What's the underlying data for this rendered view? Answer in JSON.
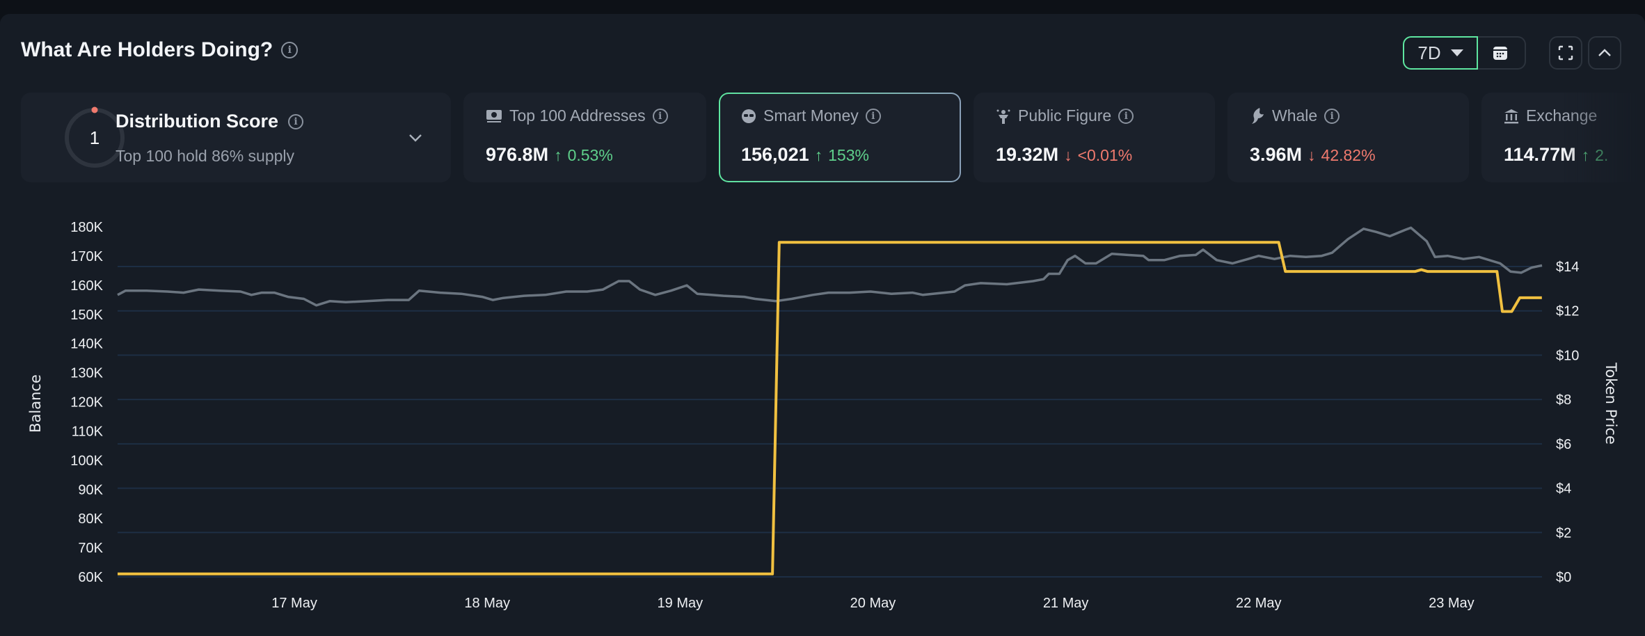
{
  "header": {
    "title": "What Are Holders Doing?",
    "range": "7D"
  },
  "colors": {
    "accent": "#5ee6a0",
    "balance_line": "#f0c040",
    "price_line": "#6b7580",
    "up": "#5fd08b",
    "down": "#f07a6e",
    "grid": "#1d2e44"
  },
  "distribution": {
    "score": "1",
    "title": "Distribution Score",
    "subtitle": "Top 100 hold 86% supply"
  },
  "cards": [
    {
      "icon": "money-stack-icon",
      "label": "Top 100 Addresses",
      "value": "976.8M",
      "change": "0.53%",
      "direction": "up",
      "arrow": "↑"
    },
    {
      "icon": "sunglasses-icon",
      "label": "Smart Money",
      "value": "156,021",
      "change": "153%",
      "direction": "up",
      "arrow": "↑",
      "selected": true
    },
    {
      "icon": "public-figure-icon",
      "label": "Public Figure",
      "value": "19.32M",
      "change": "<0.01%",
      "direction": "down",
      "arrow": "↓"
    },
    {
      "icon": "whale-icon",
      "label": "Whale",
      "value": "3.96M",
      "change": "42.82%",
      "direction": "down",
      "arrow": "↓"
    },
    {
      "icon": "bank-icon",
      "label": "Exchange",
      "value": "114.77M",
      "change": "2.",
      "direction": "up",
      "arrow": "↑"
    }
  ],
  "chart_data": {
    "type": "line",
    "left_axis": {
      "label": "Balance",
      "ylim": [
        60000,
        180000
      ],
      "ticks": [
        "180K",
        "170K",
        "160K",
        "150K",
        "140K",
        "130K",
        "120K",
        "110K",
        "100K",
        "90K",
        "80K",
        "70K",
        "60K"
      ]
    },
    "right_axis": {
      "label": "Token Price",
      "ylim": [
        0,
        16
      ],
      "ticks": [
        "$14",
        "$12",
        "$10",
        "$8",
        "$6",
        "$4",
        "$2",
        "$0"
      ]
    },
    "x_ticks": [
      "17 May",
      "18 May",
      "19 May",
      "20 May",
      "21 May",
      "22 May",
      "23 May"
    ],
    "xlim": [
      "05-16 02:00",
      "05-23 11:16"
    ],
    "grid": "horizontal at right-axis ticks",
    "series": [
      {
        "axis": "left",
        "color": "#f0c040",
        "step": true,
        "points": [
          [
            "05-16 02:00",
            61000
          ],
          [
            "05-19 11:30",
            61000
          ],
          [
            "05-19 12:20",
            174700
          ],
          [
            "05-22 02:30",
            174700
          ],
          [
            "05-22 03:20",
            164700
          ],
          [
            "05-22 19:30",
            164700
          ],
          [
            "05-22 20:15",
            165300
          ],
          [
            "05-22 21:00",
            164700
          ],
          [
            "05-23 05:40",
            164700
          ],
          [
            "05-23 06:20",
            151000
          ],
          [
            "05-23 07:30",
            151000
          ],
          [
            "05-23 08:30",
            155700
          ],
          [
            "05-23 11:15",
            155700
          ]
        ]
      },
      {
        "axis": "right",
        "color": "#6b7580",
        "points": [
          [
            "05-16 02:00",
            12.72
          ],
          [
            "05-16 03:00",
            12.91
          ],
          [
            "05-16 05:36",
            12.91
          ],
          [
            "05-16 08:12",
            12.87
          ],
          [
            "05-16 10:12",
            12.82
          ],
          [
            "05-16 12:06",
            12.96
          ],
          [
            "05-16 14:42",
            12.91
          ],
          [
            "05-16 17:18",
            12.87
          ],
          [
            "05-16 18:39",
            12.72
          ],
          [
            "05-16 19:57",
            12.82
          ],
          [
            "05-16 21:30",
            12.82
          ],
          [
            "05-16 23:12",
            12.63
          ],
          [
            "05-17 01:11",
            12.54
          ],
          [
            "05-17 02:44",
            12.25
          ],
          [
            "05-17 04:26",
            12.44
          ],
          [
            "05-17 06:24",
            12.39
          ],
          [
            "05-17 09:00",
            12.44
          ],
          [
            "05-17 11:36",
            12.49
          ],
          [
            "05-17 14:14",
            12.49
          ],
          [
            "05-17 15:32",
            12.91
          ],
          [
            "05-17 18:09",
            12.82
          ],
          [
            "05-17 20:46",
            12.77
          ],
          [
            "05-17 23:23",
            12.63
          ],
          [
            "05-18 00:41",
            12.49
          ],
          [
            "05-18 02:00",
            12.58
          ],
          [
            "05-18 04:36",
            12.68
          ],
          [
            "05-18 07:13",
            12.72
          ],
          [
            "05-18 09:50",
            12.87
          ],
          [
            "05-18 12:26",
            12.87
          ],
          [
            "05-18 14:24",
            12.96
          ],
          [
            "05-18 16:21",
            13.34
          ],
          [
            "05-18 17:40",
            13.34
          ],
          [
            "05-18 19:00",
            12.96
          ],
          [
            "05-18 20:55",
            12.72
          ],
          [
            "05-18 22:53",
            12.91
          ],
          [
            "05-19 00:50",
            13.15
          ],
          [
            "05-19 02:08",
            12.77
          ],
          [
            "05-19 05:24",
            12.68
          ],
          [
            "05-19 08:00",
            12.63
          ],
          [
            "05-19 09:20",
            12.54
          ],
          [
            "05-19 11:57",
            12.44
          ],
          [
            "05-19 13:54",
            12.54
          ],
          [
            "05-19 16:31",
            12.72
          ],
          [
            "05-19 18:28",
            12.82
          ],
          [
            "05-19 21:05",
            12.82
          ],
          [
            "05-19 23:42",
            12.87
          ],
          [
            "05-20 02:18",
            12.77
          ],
          [
            "05-20 04:55",
            12.82
          ],
          [
            "05-20 06:13",
            12.72
          ],
          [
            "05-20 08:50",
            12.82
          ],
          [
            "05-20 10:09",
            12.87
          ],
          [
            "05-20 11:27",
            13.15
          ],
          [
            "05-20 13:25",
            13.25
          ],
          [
            "05-20 16:40",
            13.2
          ],
          [
            "05-20 19:56",
            13.34
          ],
          [
            "05-20 21:14",
            13.43
          ],
          [
            "05-20 21:53",
            13.67
          ],
          [
            "05-20 23:12",
            13.67
          ],
          [
            "05-21 00:14",
            14.29
          ],
          [
            "05-21 01:09",
            14.48
          ],
          [
            "05-21 02:27",
            14.14
          ],
          [
            "05-21 03:46",
            14.14
          ],
          [
            "05-21 05:44",
            14.57
          ],
          [
            "05-21 07:41",
            14.52
          ],
          [
            "05-21 09:39",
            14.48
          ],
          [
            "05-21 10:18",
            14.29
          ],
          [
            "05-21 12:15",
            14.29
          ],
          [
            "05-21 14:13",
            14.48
          ],
          [
            "05-21 16:10",
            14.52
          ],
          [
            "05-21 17:05",
            14.76
          ],
          [
            "05-21 18:47",
            14.29
          ],
          [
            "05-21 20:45",
            14.14
          ],
          [
            "05-21 22:42",
            14.34
          ],
          [
            "05-22 00:00",
            14.48
          ],
          [
            "05-22 01:58",
            14.34
          ],
          [
            "05-22 03:55",
            14.48
          ],
          [
            "05-22 05:53",
            14.43
          ],
          [
            "05-22 07:51",
            14.48
          ],
          [
            "05-22 09:09",
            14.62
          ],
          [
            "05-22 11:06",
            15.23
          ],
          [
            "05-22 13:04",
            15.7
          ],
          [
            "05-22 14:38",
            15.56
          ],
          [
            "05-22 16:20",
            15.37
          ],
          [
            "05-22 18:17",
            15.66
          ],
          [
            "05-22 18:57",
            15.75
          ],
          [
            "05-22 20:55",
            15.14
          ],
          [
            "05-22 21:57",
            14.43
          ],
          [
            "05-22 23:31",
            14.48
          ],
          [
            "05-23 01:29",
            14.34
          ],
          [
            "05-23 03:26",
            14.43
          ],
          [
            "05-23 06:03",
            14.14
          ],
          [
            "05-23 07:21",
            13.77
          ],
          [
            "05-23 08:40",
            13.72
          ],
          [
            "05-23 09:58",
            13.95
          ],
          [
            "05-23 11:16",
            14.05
          ]
        ]
      }
    ]
  }
}
